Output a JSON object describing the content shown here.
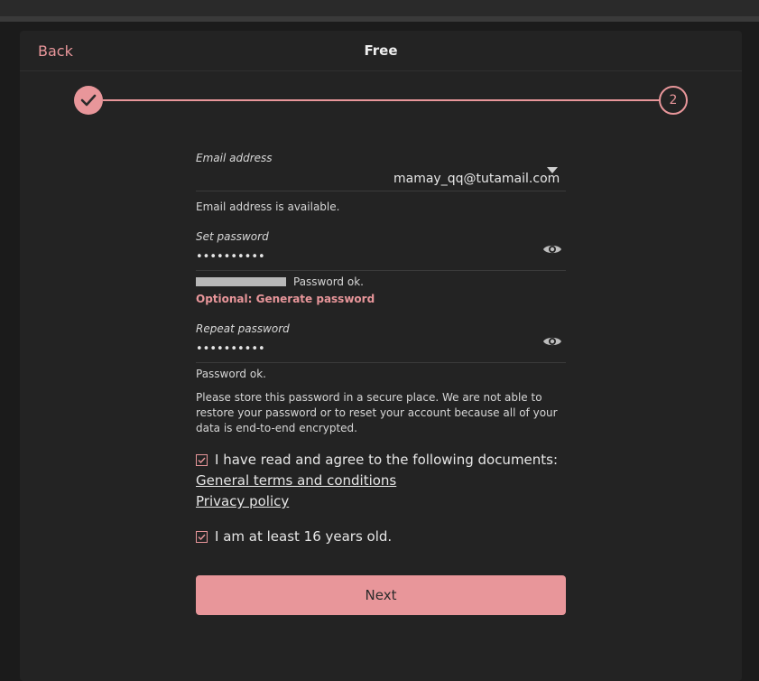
{
  "header": {
    "back_label": "Back",
    "title": "Free"
  },
  "stepper": {
    "current_step": "2",
    "accent_color": "#e8969a"
  },
  "email": {
    "label": "Email address",
    "value": "mamay_qq@tutamail.com",
    "status": "Email address is available."
  },
  "password": {
    "label": "Set password",
    "masked_value": "••••••••••",
    "status": "Password ok.",
    "generate_link": "Optional: Generate password"
  },
  "repeat_password": {
    "label": "Repeat password",
    "masked_value": "••••••••••",
    "status": "Password ok."
  },
  "notice": "Please store this password in a secure place. We are not able to restore your password or to reset your account because all of your data is end-to-end encrypted.",
  "terms": {
    "checkbox_label": "I have read and agree to the following documents:",
    "link_terms": "General terms and conditions",
    "link_privacy": "Privacy policy"
  },
  "age": {
    "checkbox_label": "I am at least 16 years old."
  },
  "next_label": "Next",
  "icons": {
    "step_done": "checkmark-icon",
    "dropdown": "chevron-down-icon",
    "show_password": "eye-icon",
    "checkbox": "checkbox-checked-icon"
  }
}
